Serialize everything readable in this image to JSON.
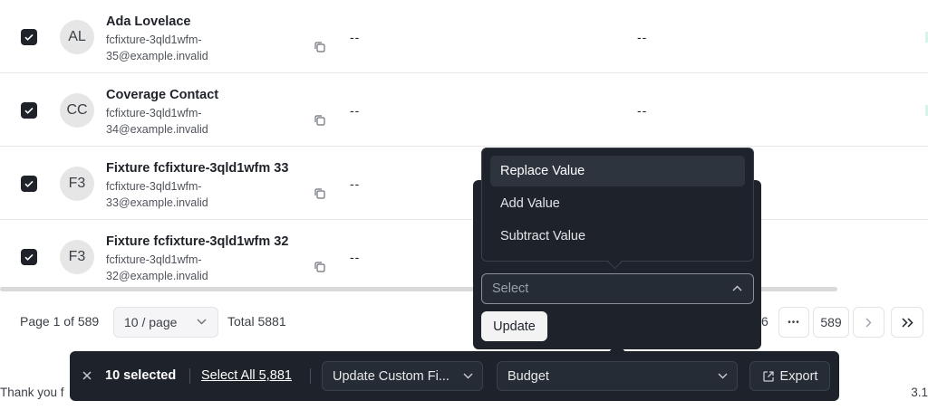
{
  "rows": [
    {
      "checked": true,
      "initials": "AL",
      "name": "Ada Lovelace",
      "email": "fcfixture-3qld1wfm-35@example.invalid",
      "col1": "--",
      "col2": "--"
    },
    {
      "checked": true,
      "initials": "CC",
      "name": "Coverage Contact",
      "email": "fcfixture-3qld1wfm-34@example.invalid",
      "col1": "--",
      "col2": "--"
    },
    {
      "checked": true,
      "initials": "F3",
      "name": "Fixture fcfixture-3qld1wfm 33",
      "email": "fcfixture-3qld1wfm-33@example.invalid",
      "col1": "--",
      "col2": ""
    },
    {
      "checked": true,
      "initials": "F3",
      "name": "Fixture fcfixture-3qld1wfm 32",
      "email": "fcfixture-3qld1wfm-32@example.invalid",
      "col1": "--",
      "col2": ""
    }
  ],
  "pagination": {
    "page_text": "Page 1 of 589",
    "page_size": "10 / page",
    "total": "Total 5881",
    "partial_page": "6",
    "ellipsis": "•••",
    "last_page": "589",
    "next_icon": "chevron-right-icon",
    "last_icon": "double-chevron-right-icon"
  },
  "footer": {
    "left_text": "Thank you f",
    "right_text": "3.1"
  },
  "bulk_bar": {
    "close_icon": "close-icon",
    "selected_count": "10 selected",
    "select_all": "Select All 5,881",
    "action": "Update Custom Fi...",
    "field": "Budget",
    "export": "Export"
  },
  "update_popover": {
    "select_placeholder": "Select",
    "update_button": "Update",
    "menu": [
      {
        "label": "Replace Value",
        "active": true
      },
      {
        "label": "Add Value",
        "active": false
      },
      {
        "label": "Subtract Value",
        "active": false
      }
    ]
  },
  "colors": {
    "dark_panel": "#1e232b",
    "checkbox": "#1f2329"
  }
}
